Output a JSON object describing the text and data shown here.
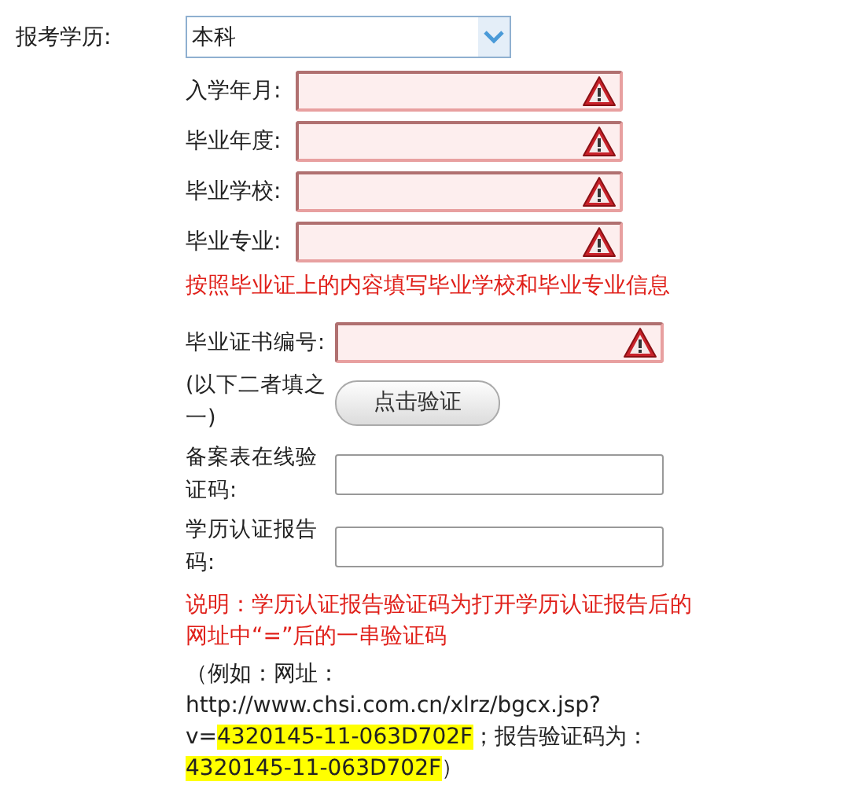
{
  "education": {
    "label": "报考学历:",
    "value": "本科"
  },
  "fields": [
    {
      "label": "入学年月:",
      "invalid": true
    },
    {
      "label": "毕业年度:",
      "invalid": true
    },
    {
      "label": "毕业学校:",
      "invalid": true
    },
    {
      "label": "毕业专业:",
      "invalid": true
    }
  ],
  "fields_note": "按照毕业证上的内容填写毕业学校和毕业专业信息",
  "certificate": {
    "label": "毕业证书编号:",
    "invalid": true
  },
  "either_one": {
    "label": "(以下二者填之一)",
    "button": "点击验证"
  },
  "codes": [
    {
      "label": "备案表在线验证码:",
      "invalid": false
    },
    {
      "label": "学历认证报告码:",
      "invalid": false
    }
  ],
  "explanation": "说明：学历认证报告验证码为打开学历认证报告后的网址中“=”后的一串验证码",
  "example": [
    {
      "text": "（例如：网址：http://www.chsi.com.cn/xlrz/bgcx.jsp?v=",
      "highlight": false
    },
    {
      "text": "4320145-11-063D702F",
      "highlight": true
    },
    {
      "text": "；报告验证码为：",
      "highlight": false
    },
    {
      "text": "4320145-11-063D702F",
      "highlight": true
    },
    {
      "text": "）",
      "highlight": false
    }
  ]
}
